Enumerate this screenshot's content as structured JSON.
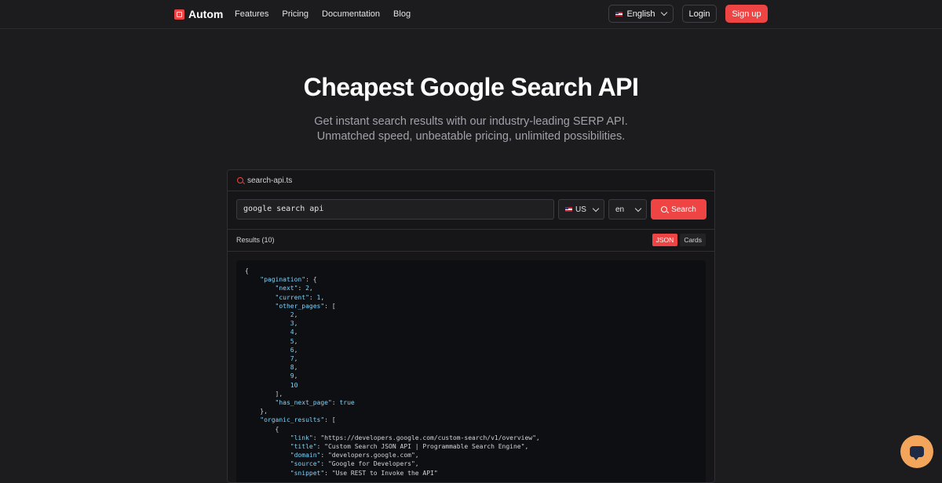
{
  "nav": {
    "brand": "Autom",
    "links": [
      "Features",
      "Pricing",
      "Documentation",
      "Blog"
    ],
    "language": "English",
    "login": "Login",
    "signup": "Sign up"
  },
  "hero": {
    "title": "Cheapest Google Search API",
    "subtitle_line1": "Get instant search results with our industry-leading SERP API.",
    "subtitle_line2": "Unmatched speed, unbeatable pricing, unlimited possibilities."
  },
  "demo": {
    "filename": "search-api.ts",
    "query": "google search api",
    "country": "US",
    "language": "en",
    "search_label": "Search",
    "results_label": "Results (10)",
    "view_json": "JSON",
    "view_cards": "Cards",
    "code_lines": [
      "{",
      "    \"pagination\": {",
      "        \"next\": 2,",
      "        \"current\": 1,",
      "        \"other_pages\": [",
      "            2,",
      "            3,",
      "            4,",
      "            5,",
      "            6,",
      "            7,",
      "            8,",
      "            9,",
      "            10",
      "        ],",
      "        \"has_next_page\": true",
      "    },",
      "    \"organic_results\": [",
      "        {",
      "            \"link\": \"https://developers.google.com/custom-search/v1/overview\",",
      "            \"title\": \"Custom Search JSON API | Programmable Search Engine\",",
      "            \"domain\": \"developers.google.com\",",
      "            \"source\": \"Google for Developers\",",
      "            \"snippet\": \"Use REST to Invoke the API\""
    ]
  },
  "colors": {
    "accent": "#ef4444",
    "background": "#1c1c1e",
    "code_key": "#7dd3fc"
  }
}
